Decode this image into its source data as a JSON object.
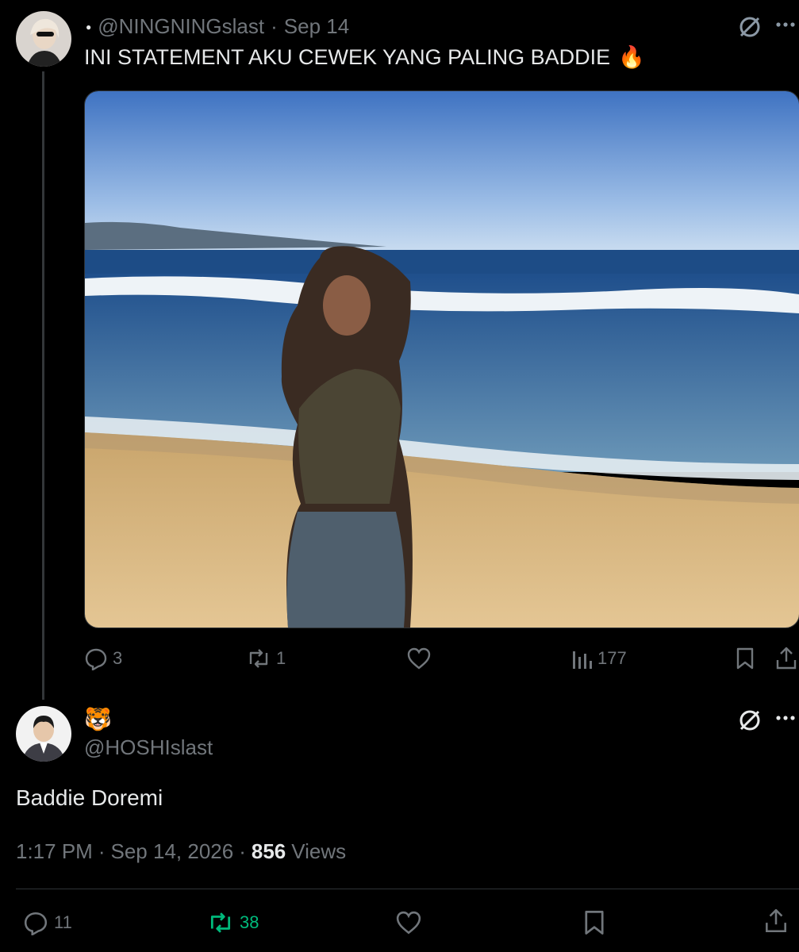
{
  "reply_to": {
    "handle": "@NINGNINGslast",
    "separator": "·",
    "date": "Sep 14",
    "text": "INI STATEMENT AKU CEWEK YANG PALING BADDIE",
    "emoji": "🔥",
    "stats": {
      "replies": "3",
      "reposts": "1",
      "views": "177"
    }
  },
  "main_tweet": {
    "display_name": "🐯",
    "handle": "@HOSHIslast",
    "text": "Baddie Doremi",
    "time": "1:17 PM",
    "dot": "·",
    "date": "Sep 14, 2026",
    "dot2": "·",
    "views_count": "856",
    "views_label": "Views",
    "stats": {
      "replies": "11",
      "reposts": "38"
    }
  },
  "colors": {
    "repost_active": "#00ba7c",
    "muted": "#71767b",
    "text": "#e7e9ea"
  }
}
